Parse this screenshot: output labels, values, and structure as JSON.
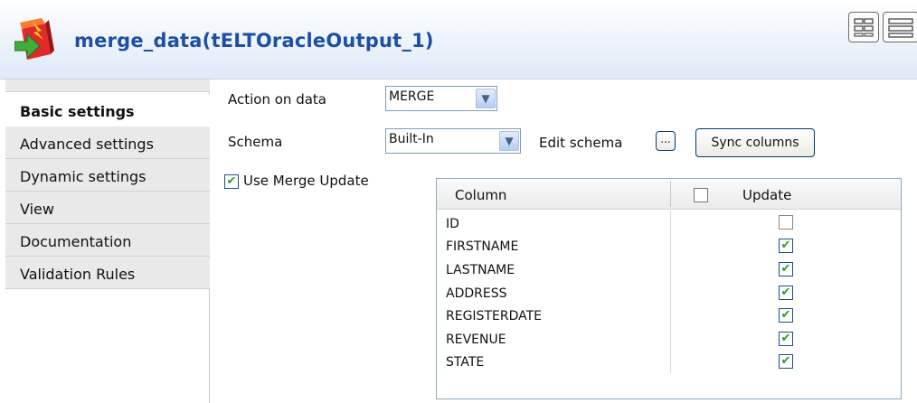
{
  "header": {
    "title": "merge_data(tELTOracleOutput_1)",
    "icon": "orange-component-icon"
  },
  "sidebar": {
    "tabs": [
      {
        "label": "Basic settings",
        "active": true
      },
      {
        "label": "Advanced settings",
        "active": false
      },
      {
        "label": "Dynamic settings",
        "active": false
      },
      {
        "label": "View",
        "active": false
      },
      {
        "label": "Documentation",
        "active": false
      },
      {
        "label": "Validation Rules",
        "active": false
      }
    ]
  },
  "form": {
    "action_label": "Action on data",
    "action_value": "MERGE",
    "schema_label": "Schema",
    "schema_value": "Built-In",
    "edit_schema_label": "Edit schema",
    "edit_schema_button": "...",
    "sync_columns": "Sync columns",
    "use_merge_update_label": "Use Merge Update",
    "use_merge_update_checked": true
  },
  "table": {
    "headers": {
      "column": "Column",
      "update": "Update"
    },
    "rows": [
      {
        "column": "ID",
        "update": false
      },
      {
        "column": "FIRSTNAME",
        "update": true
      },
      {
        "column": "LASTNAME",
        "update": true
      },
      {
        "column": "ADDRESS",
        "update": true
      },
      {
        "column": "REGISTERDATE",
        "update": true
      },
      {
        "column": "REVENUE",
        "update": true
      },
      {
        "column": "STATE",
        "update": true
      }
    ]
  },
  "colors": {
    "title": "#1f4fa3",
    "check": "#21a121",
    "border": "#7f9db9"
  }
}
